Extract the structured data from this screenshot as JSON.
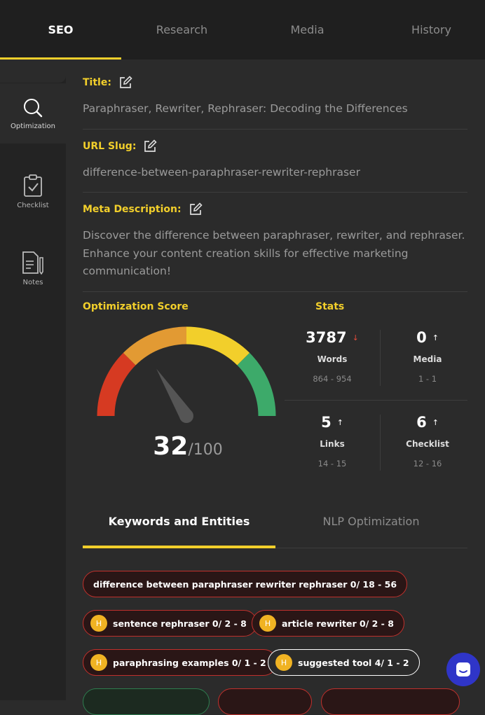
{
  "top_tabs": [
    {
      "label": "SEO",
      "active": true
    },
    {
      "label": "Research",
      "active": false
    },
    {
      "label": "Media",
      "active": false
    },
    {
      "label": "History",
      "active": false
    }
  ],
  "rail": [
    {
      "label": "Optimization",
      "icon": "search-icon",
      "active": true
    },
    {
      "label": "Checklist",
      "icon": "clipboard-check-icon",
      "active": false
    },
    {
      "label": "Notes",
      "icon": "notes-icon",
      "active": false
    }
  ],
  "fields": {
    "title": {
      "label": "Title:",
      "value": "Paraphraser, Rewriter, Rephraser: Decoding the Differences"
    },
    "slug": {
      "label": "URL Slug:",
      "value": "difference-between-paraphraser-rewriter-rephraser"
    },
    "meta": {
      "label": "Meta Description:",
      "value": "Discover the difference between paraphraser, rewriter, and rephraser. Enhance your content creation skills for effective marketing communication!"
    }
  },
  "optimization": {
    "title": "Optimization Score",
    "score": "32",
    "max": "/100",
    "score_value": 32,
    "colors": {
      "red": "#d63a22",
      "orange": "#e29a33",
      "yellow": "#f2cf2b",
      "green": "#3daa6a"
    }
  },
  "stats": {
    "title": "Stats",
    "items": [
      {
        "value": "3787",
        "arrow": "↓",
        "arrow_color": "#e24b3b",
        "name": "Words",
        "range": "864 - 954"
      },
      {
        "value": "0",
        "arrow": "↑",
        "arrow_color": "#ffffff",
        "name": "Media",
        "range": "1 - 1"
      },
      {
        "value": "5",
        "arrow": "↑",
        "arrow_color": "#ffffff",
        "name": "Links",
        "range": "14 - 15"
      },
      {
        "value": "6",
        "arrow": "↑",
        "arrow_color": "#ffffff",
        "name": "Checklist",
        "range": "12 - 16"
      }
    ]
  },
  "sub_tabs": [
    {
      "label": "Keywords and Entities",
      "active": true
    },
    {
      "label": "NLP Optimization",
      "active": false
    }
  ],
  "keywords": [
    {
      "text": "difference between paraphraser rewriter rephraser 0/ 18 - 56",
      "badge": "",
      "style": "red"
    },
    {
      "text": "sentence rephraser 0/ 2 - 8",
      "badge": "H",
      "style": "red"
    },
    {
      "text": "article rewriter 0/ 2 - 8",
      "badge": "H",
      "style": "red"
    },
    {
      "text": "paraphrasing examples 0/ 1 - 2",
      "badge": "H",
      "style": "red"
    },
    {
      "text": "suggested tool 4/ 1 - 2",
      "badge": "H",
      "style": "white"
    },
    {
      "text": "",
      "badge": "",
      "style": "green"
    },
    {
      "text": "",
      "badge": "",
      "style": "red"
    },
    {
      "text": "",
      "badge": "",
      "style": "red"
    }
  ]
}
